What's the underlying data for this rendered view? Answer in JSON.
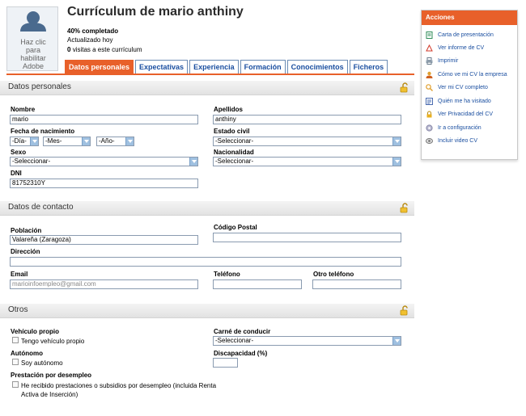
{
  "photo": {
    "text": "Haz clic\npara\nhabilitar\nAdobe\nFlash"
  },
  "header": {
    "title": "Currículum de mario anthiny",
    "completion": "40% completado",
    "updated": "Actualizado hoy",
    "visits_count": "0",
    "visits_text": "visitas a este currículum"
  },
  "tabs": [
    {
      "label": "Datos personales",
      "active": true
    },
    {
      "label": "Expectativas"
    },
    {
      "label": "Experiencia"
    },
    {
      "label": "Formación"
    },
    {
      "label": "Conocimientos"
    },
    {
      "label": "Ficheros"
    }
  ],
  "personal": {
    "title": "Datos personales",
    "nombre_label": "Nombre",
    "nombre_value": "mario",
    "apellidos_label": "Apellidos",
    "apellidos_value": "anthiny",
    "fecha_label": "Fecha de nacimiento",
    "dia": "-Día-",
    "mes": "-Mes-",
    "anio": "-Año-",
    "estado_label": "Estado civil",
    "estado_value": "-Seleccionar-",
    "sexo_label": "Sexo",
    "sexo_value": "-Seleccionar-",
    "nacionalidad_label": "Nacionalidad",
    "nacionalidad_value": "-Seleccionar-",
    "dni_label": "DNI",
    "dni_value": "81752310Y"
  },
  "contact": {
    "title": "Datos de contacto",
    "poblacion_label": "Población",
    "poblacion_value": "Valareña (Zaragoza)",
    "cp_label": "Código Postal",
    "cp_value": "",
    "direccion_label": "Dirección",
    "direccion_value": "",
    "email_label": "Email",
    "email_value": "marioinfoempleo@gmail.com",
    "telefono_label": "Teléfono",
    "telefono_value": "",
    "otro_label": "Otro teléfono",
    "otro_value": ""
  },
  "otros": {
    "title": "Otros",
    "vehiculo_label": "Vehículo propio",
    "vehiculo_check": "Tengo vehículo propio",
    "carne_label": "Carné de conducir",
    "carne_value": "-Seleccionar-",
    "autonomo_label": "Autónomo",
    "autonomo_check": "Soy autónomo",
    "discapacidad_label": "Discapacidad (%)",
    "discapacidad_value": "",
    "prestacion_label": "Prestación por desempleo",
    "prestacion_check": "He recibido prestaciones o subsidios por desempleo (incluida Renta Activa de Inserción)"
  },
  "actions": {
    "title": "Acciones",
    "items": [
      {
        "label": "Carta de presentación",
        "icon": "letter-icon",
        "color": "#2e8b57"
      },
      {
        "label": "Ver informe de CV",
        "icon": "pdf-icon",
        "color": "#d23a2a"
      },
      {
        "label": "Imprimir",
        "icon": "printer-icon",
        "color": "#6a7b8c"
      },
      {
        "label": "Cómo ve mi CV la empresa",
        "icon": "company-icon",
        "color": "#e0a030"
      },
      {
        "label": "Ver mi CV completo",
        "icon": "magnifier-icon",
        "color": "#e0a030"
      },
      {
        "label": "Quién me ha visitado",
        "icon": "visitors-icon",
        "color": "#4b6cb0"
      },
      {
        "label": "Ver Privacidad del CV",
        "icon": "lock-icon",
        "color": "#e8b020"
      },
      {
        "label": "Ir a configuración",
        "icon": "gear-icon",
        "color": "#8a8aa8"
      },
      {
        "label": "Incluir video CV",
        "icon": "video-icon",
        "color": "#777777"
      }
    ]
  },
  "colors": {
    "accent": "#e8602a",
    "link": "#1b4fa0",
    "tab_border": "#6b8cb4"
  }
}
